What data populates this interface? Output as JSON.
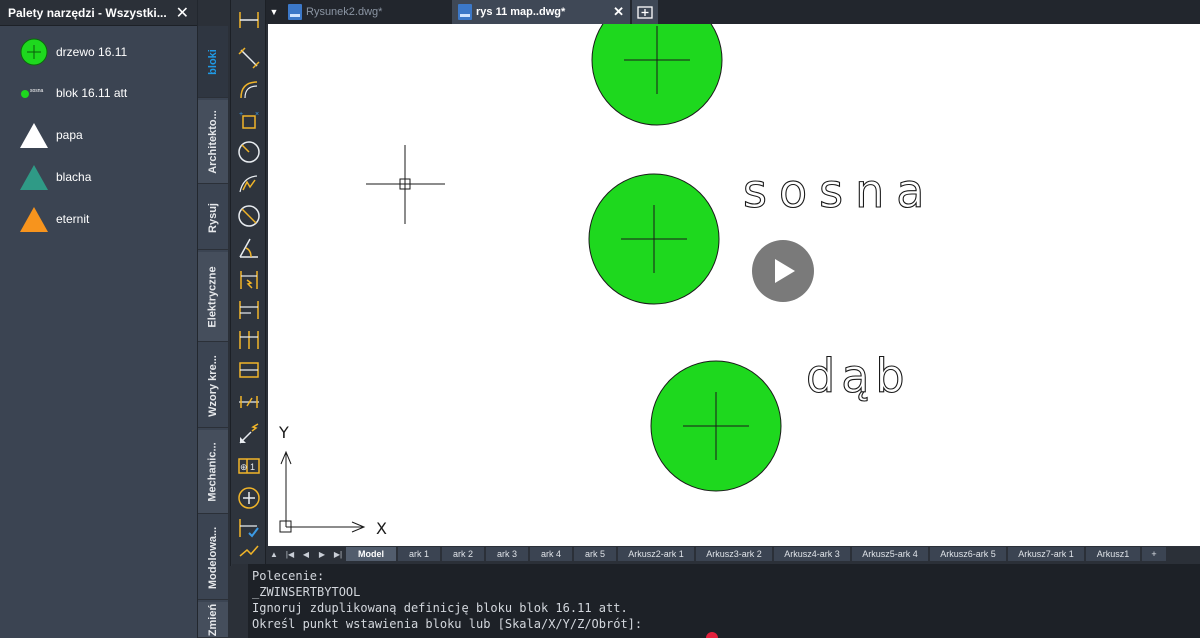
{
  "palette": {
    "title": "Palety narzędzi - Wszystki...",
    "items": [
      {
        "label": "drzewo 16.11",
        "icon": "green-circle-icon"
      },
      {
        "label": "blok 16.11 att",
        "icon": "small-green-circle-icon",
        "icon_text": "sosna"
      },
      {
        "label": "papa",
        "icon": "white-triangle-icon"
      },
      {
        "label": "blacha",
        "icon": "teal-triangle-icon"
      },
      {
        "label": "eternit",
        "icon": "orange-triangle-icon"
      }
    ],
    "tabs": [
      "bloki",
      "Architekto...",
      "Rysuj",
      "Elektryczne",
      "Wzory kre...",
      "Mechanic...",
      "Modelowa...",
      "Zmień"
    ]
  },
  "doc_tabs": [
    {
      "label": "Rysunek2.dwg*",
      "active": false
    },
    {
      "label": "rys 11 map..dwg*",
      "active": true
    }
  ],
  "canvas": {
    "labels": [
      "sosna",
      "dąb"
    ],
    "ucs": {
      "x": "X",
      "y": "Y"
    }
  },
  "layout_tabs": [
    "Model",
    "ark 1",
    "ark 2",
    "ark 3",
    "ark 4",
    "ark 5",
    "Arkusz2-ark 1",
    "Arkusz3-ark 2",
    "Arkusz4-ark 3",
    "Arkusz5-ark 4",
    "Arkusz6-ark 5",
    "Arkusz7-ark 1",
    "Arkusz1",
    "+"
  ],
  "command_line": [
    "Polecenie:",
    "_ZWINSERTBYTOOL",
    "Ignoruj zduplikowaną definicję bloku blok 16.11 att.",
    "Określ punkt wstawienia bloku lub [Skala/X/Y/Z/Obrót]:"
  ],
  "colors": {
    "tree_fill": "#1ed81e",
    "accent": "#1f9ae6",
    "tool_icon": "#f0b429"
  }
}
